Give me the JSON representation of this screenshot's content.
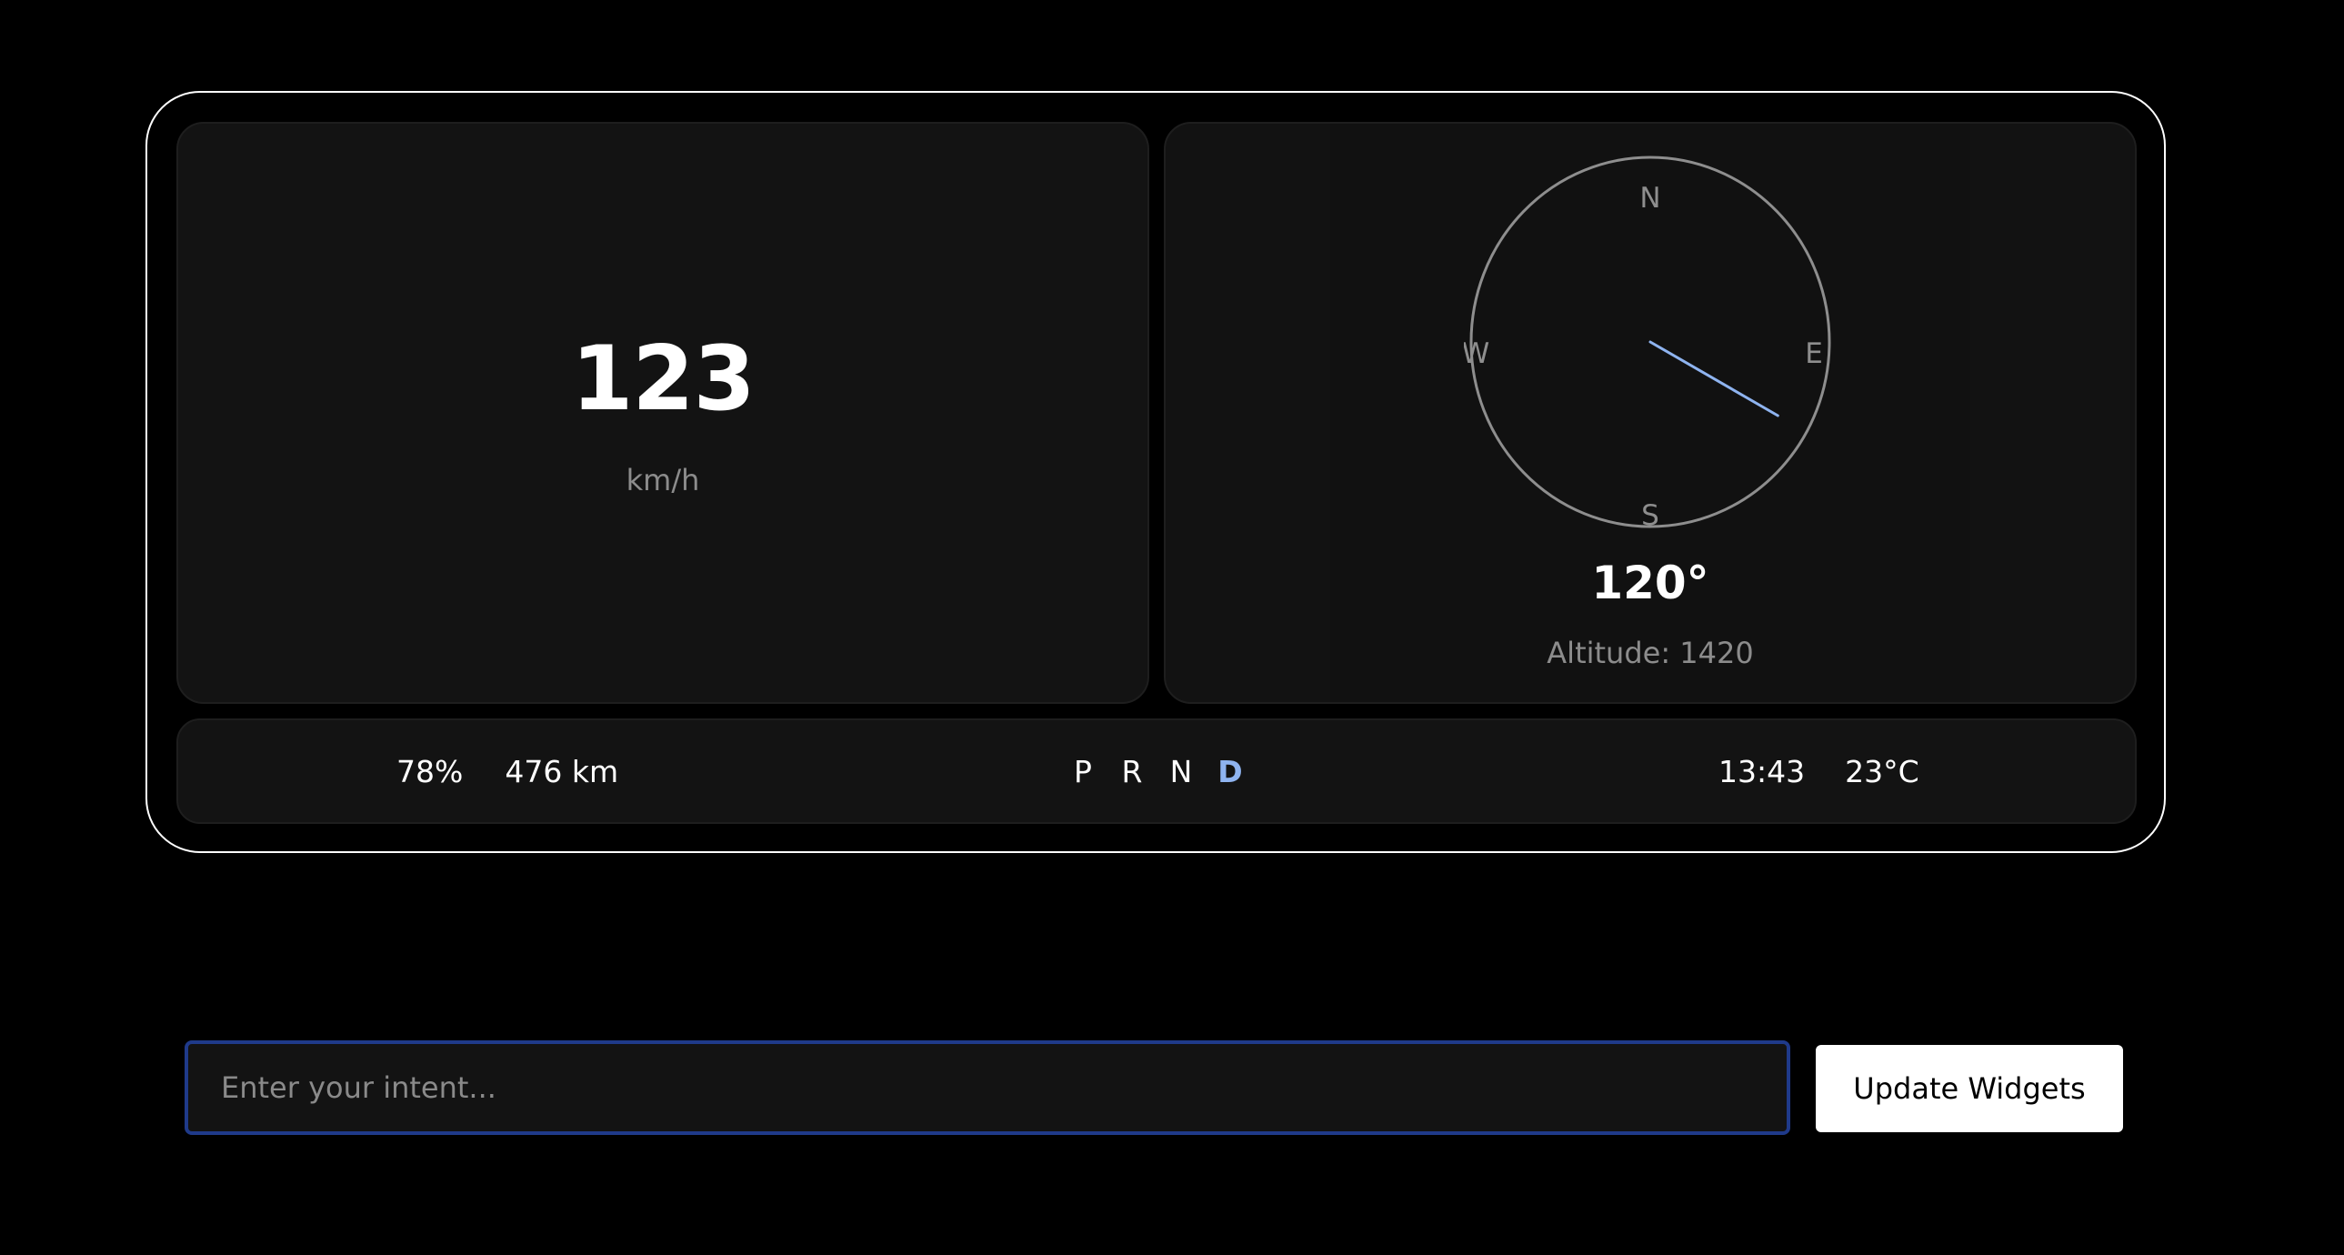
{
  "speed": {
    "value": "123",
    "unit": "km/h"
  },
  "compass": {
    "labels": {
      "n": "N",
      "e": "E",
      "s": "S",
      "w": "W"
    },
    "heading_deg": 120,
    "heading_label": "120°",
    "altitude_label": "Altitude: 1420",
    "needle_color": "#8fb4f0",
    "ring_color": "#8e8e8e"
  },
  "status": {
    "battery": "78%",
    "range": "476 km",
    "gears": [
      "P",
      "R",
      "N",
      "D"
    ],
    "active_gear": "D",
    "time": "13:43",
    "temperature": "23°C"
  },
  "intent": {
    "placeholder": "Enter your intent...",
    "value": ""
  },
  "update_button": {
    "label": "Update Widgets"
  },
  "colors": {
    "accent": "#8fb4f0",
    "input_border": "#1f3a8a",
    "panel_bg": "#131313"
  }
}
